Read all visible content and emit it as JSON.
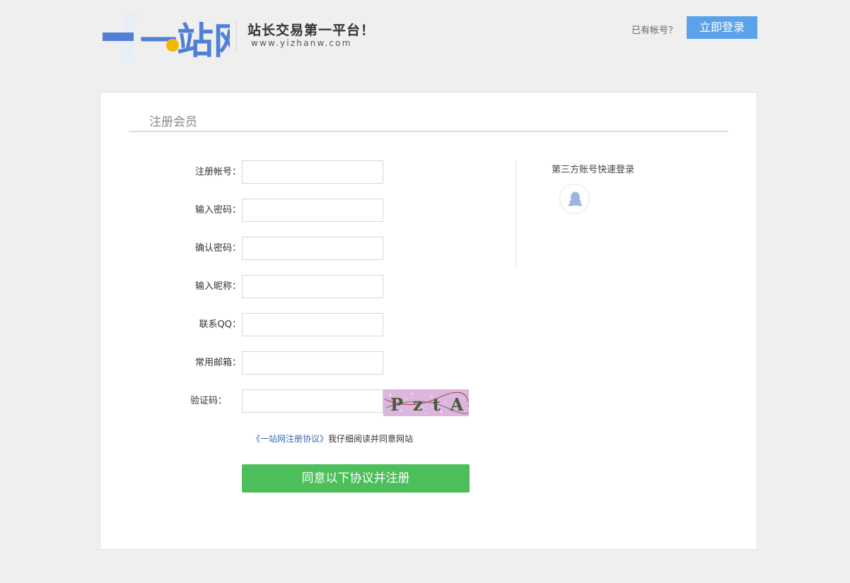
{
  "header": {
    "logo_text": "一站网",
    "slogan": "站长交易第一平台！",
    "domain": "www.yizhanw.com",
    "have_account": "已有帐号？",
    "login_label": "立即登录"
  },
  "panel": {
    "title": "注册会员",
    "fields": [
      {
        "label": "注册帐号：",
        "value": ""
      },
      {
        "label": "输入密码：",
        "value": ""
      },
      {
        "label": "确认密码：",
        "value": ""
      },
      {
        "label": "输入昵称：",
        "value": ""
      },
      {
        "label": "联系QQ：",
        "value": ""
      },
      {
        "label": "常用邮箱：",
        "value": ""
      },
      {
        "label": "验证码：",
        "value": ""
      }
    ],
    "captcha_text": "PztA",
    "agreement_link": "《一站网注册协议》",
    "agreement_text": "我仔细阅读并同意网站",
    "register_label": "同意以下协议并注册",
    "third_party_title": "第三方账号快速登录",
    "third_party_icons": [
      "qq-icon"
    ]
  },
  "colors": {
    "accent_blue": "#5aa3ea",
    "register_green": "#4cbf5a",
    "link_blue": "#3a68b2",
    "background": "#efefef"
  }
}
